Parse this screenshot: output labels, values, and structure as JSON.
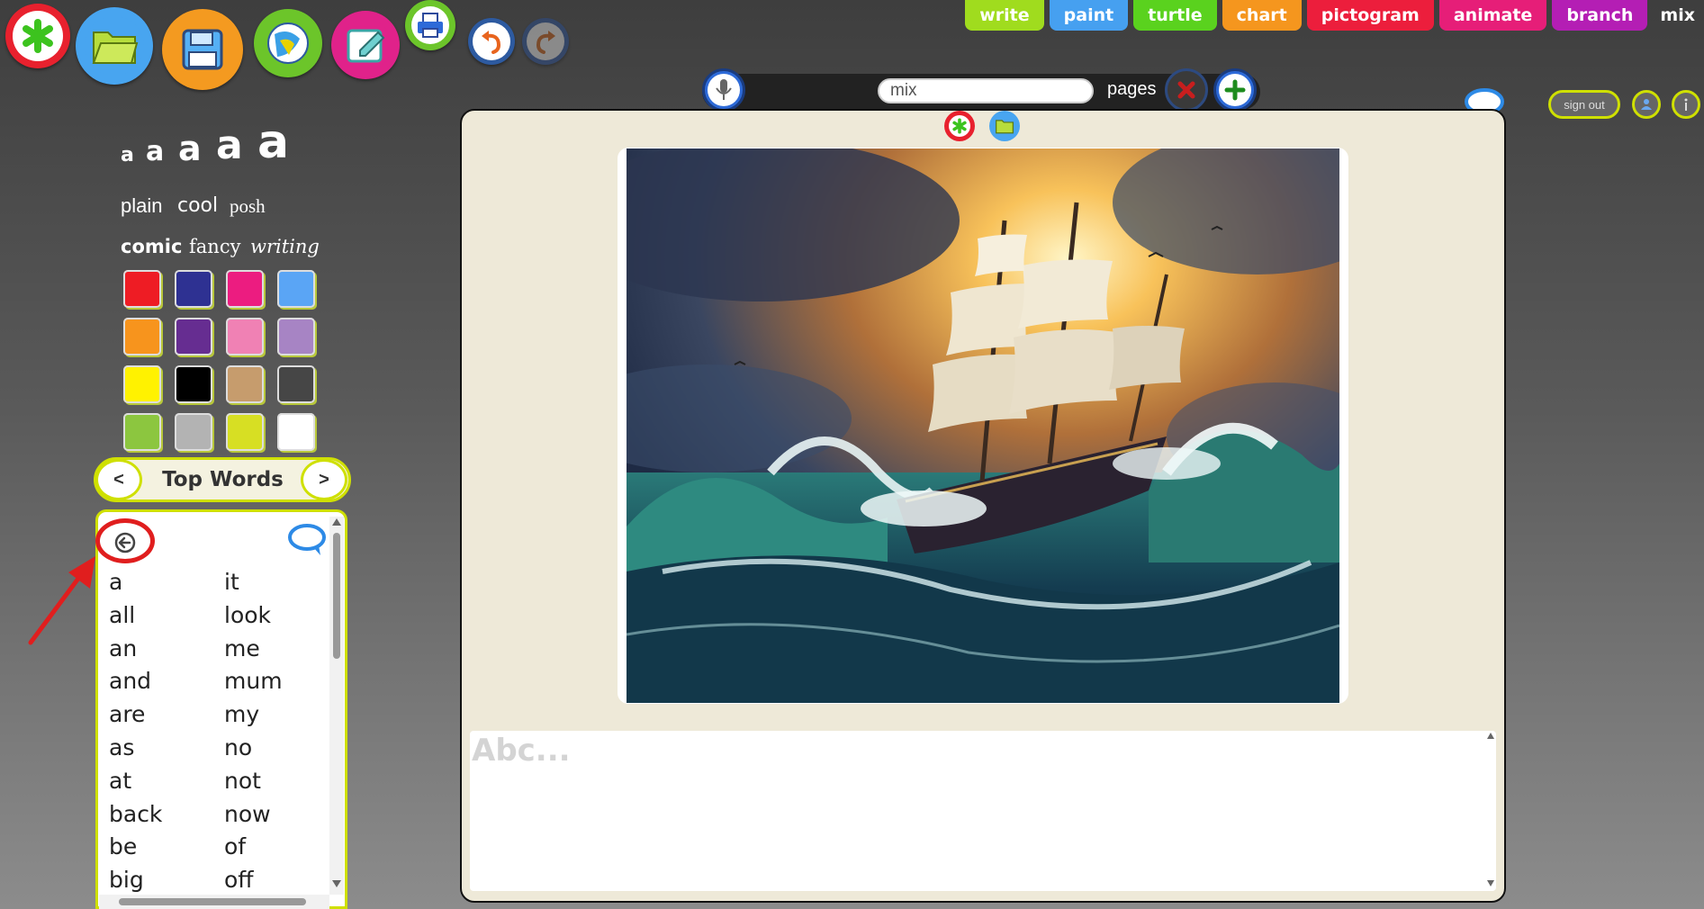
{
  "tabs": [
    {
      "label": "write",
      "color": "#a0dc1e"
    },
    {
      "label": "paint",
      "color": "#46a0f0"
    },
    {
      "label": "turtle",
      "color": "#5ad21e"
    },
    {
      "label": "chart",
      "color": "#f5961e"
    },
    {
      "label": "pictogram",
      "color": "#ec1e3c"
    },
    {
      "label": "animate",
      "color": "#e61e78"
    },
    {
      "label": "branch",
      "color": "#b41eb4"
    },
    {
      "label": "mix",
      "color": "transparent"
    }
  ],
  "pagesbar": {
    "input_value": "mix",
    "label": "pages"
  },
  "account": {
    "sign_out": "sign out"
  },
  "sizes": [
    "a",
    "a",
    "a",
    "a",
    "a"
  ],
  "fonts": {
    "row1": [
      "plain",
      "cool",
      "posh"
    ],
    "row2": [
      "comic",
      "fancy",
      "writing"
    ]
  },
  "colors": [
    "#ee1c24",
    "#2e3192",
    "#ec1c80",
    "#5aa5f5",
    "#f7941d",
    "#662d91",
    "#f081b4",
    "#a784c4",
    "#fff200",
    "#000000",
    "#c69c6d",
    "#464646",
    "#8cc63f",
    "#b3b3b3",
    "#d7df23",
    "#ffffff"
  ],
  "wordlist": {
    "title": "Top Words",
    "prev": "<",
    "next": ">",
    "col1": [
      "a",
      "all",
      "an",
      "and",
      "are",
      "as",
      "at",
      "back",
      "be",
      "big"
    ],
    "col2": [
      "it",
      "look",
      "me",
      "mum",
      "my",
      "no",
      "not",
      "now",
      "of",
      "off"
    ]
  },
  "editor": {
    "placeholder": "Abc..."
  }
}
